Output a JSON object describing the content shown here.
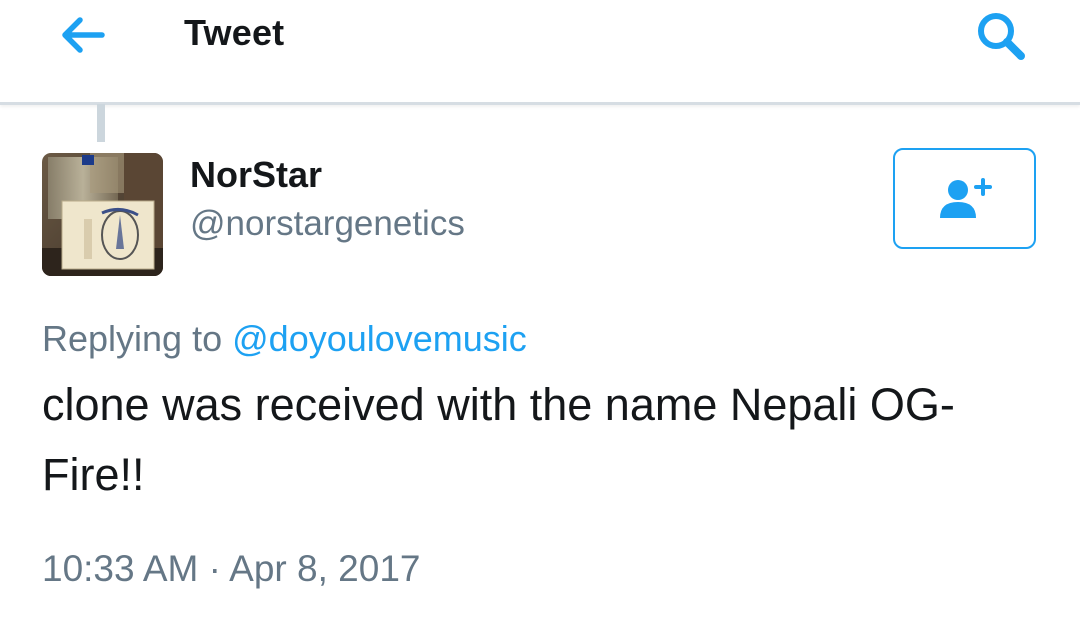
{
  "header": {
    "title": "Tweet",
    "back_icon": "arrow-left-icon",
    "search_icon": "search-icon"
  },
  "author": {
    "display_name": "NorStar",
    "handle": "@norstargenetics",
    "avatar": "photo of a labeled box",
    "follow_icon": "add-user-icon"
  },
  "tweet": {
    "replying_to_label": "Replying to",
    "replying_to_handle": "@doyoulovemusic",
    "text": "clone was received with the name Nepali OG-Fire!!",
    "timestamp": "10:33 AM · Apr 8, 2017"
  },
  "colors": {
    "accent": "#1da1f2",
    "primary_text": "#14171a",
    "secondary_text": "#657786",
    "divider": "#ccd6dd"
  }
}
